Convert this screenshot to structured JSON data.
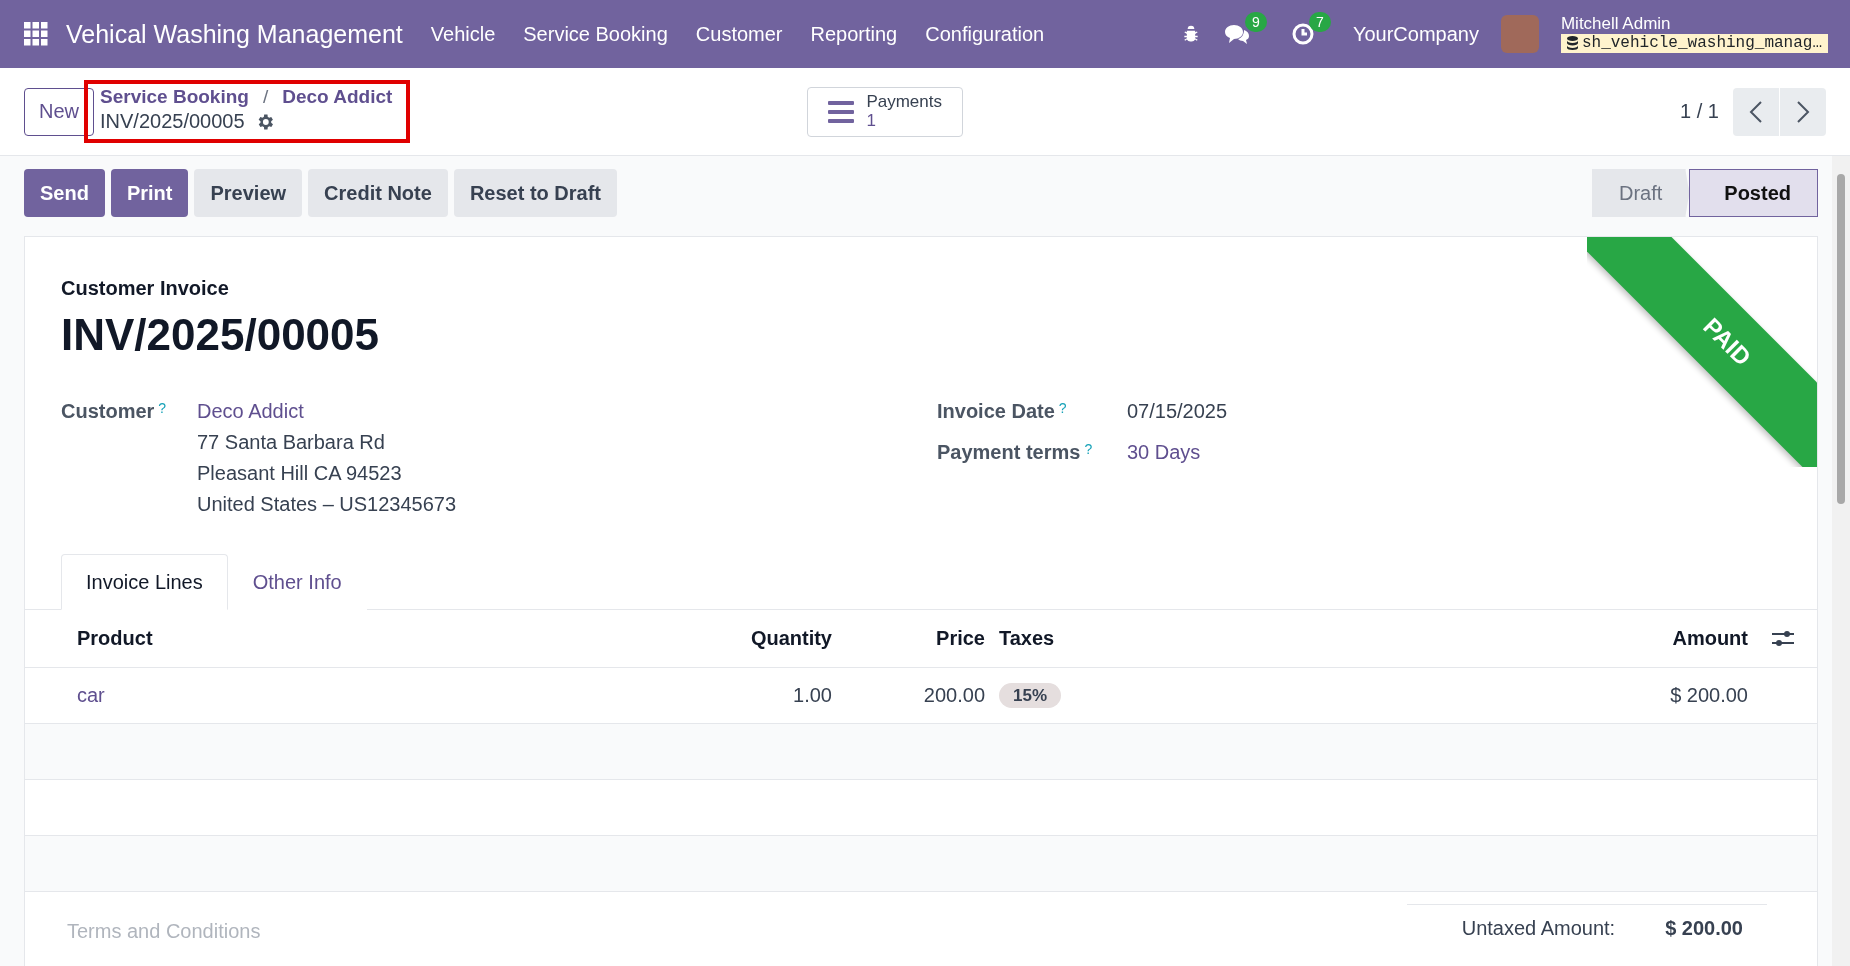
{
  "navbar": {
    "app_title": "Vehical Washing Management",
    "menu": [
      "Vehicle",
      "Service Booking",
      "Customer",
      "Reporting",
      "Configuration"
    ],
    "chat_count": "9",
    "activity_count": "7",
    "company": "YourCompany",
    "user_name": "Mitchell Admin",
    "database": "sh_vehicle_washing_manag…"
  },
  "control_panel": {
    "new_button": "New",
    "breadcrumbs": [
      "Service Booking",
      "Deco Addict"
    ],
    "breadcrumb_separator": "/",
    "record": "INV/2025/00005",
    "smart_button": {
      "label": "Payments",
      "count": "1"
    },
    "pager": "1 / 1"
  },
  "actions": [
    {
      "label": "Send",
      "kind": "primary"
    },
    {
      "label": "Print",
      "kind": "primary"
    },
    {
      "label": "Preview",
      "kind": "secondary"
    },
    {
      "label": "Credit Note",
      "kind": "secondary"
    },
    {
      "label": "Reset to Draft",
      "kind": "secondary"
    }
  ],
  "statusbar": [
    {
      "label": "Draft",
      "selected": false
    },
    {
      "label": "Posted",
      "selected": true
    }
  ],
  "ribbon": "PAID",
  "form": {
    "subtitle": "Customer Invoice",
    "name": "INV/2025/00005",
    "customer": {
      "label": "Customer",
      "help": "?",
      "value": "Deco Addict",
      "address": [
        "77 Santa Barbara Rd",
        "Pleasant Hill CA 94523",
        "United States – US12345673"
      ]
    },
    "right_fields": [
      {
        "label": "Invoice Date",
        "help": "?",
        "value": "07/15/2025",
        "kind": "text"
      },
      {
        "label": "Payment terms",
        "help": "?",
        "value": "30 Days",
        "kind": "link"
      }
    ]
  },
  "tabs": [
    {
      "label": "Invoice Lines",
      "selected": true
    },
    {
      "label": "Other Info",
      "selected": false
    }
  ],
  "table": {
    "columns": [
      "Product",
      "Quantity",
      "Price",
      "Taxes",
      "Amount"
    ],
    "rows": [
      {
        "product": "car",
        "quantity": "1.00",
        "price": "200.00",
        "taxes": "15%",
        "amount": "$ 200.00"
      }
    ]
  },
  "footer": {
    "terms_placeholder": "Terms and Conditions",
    "totals": [
      {
        "label": "Untaxed Amount:",
        "value": "$ 200.00"
      }
    ]
  }
}
